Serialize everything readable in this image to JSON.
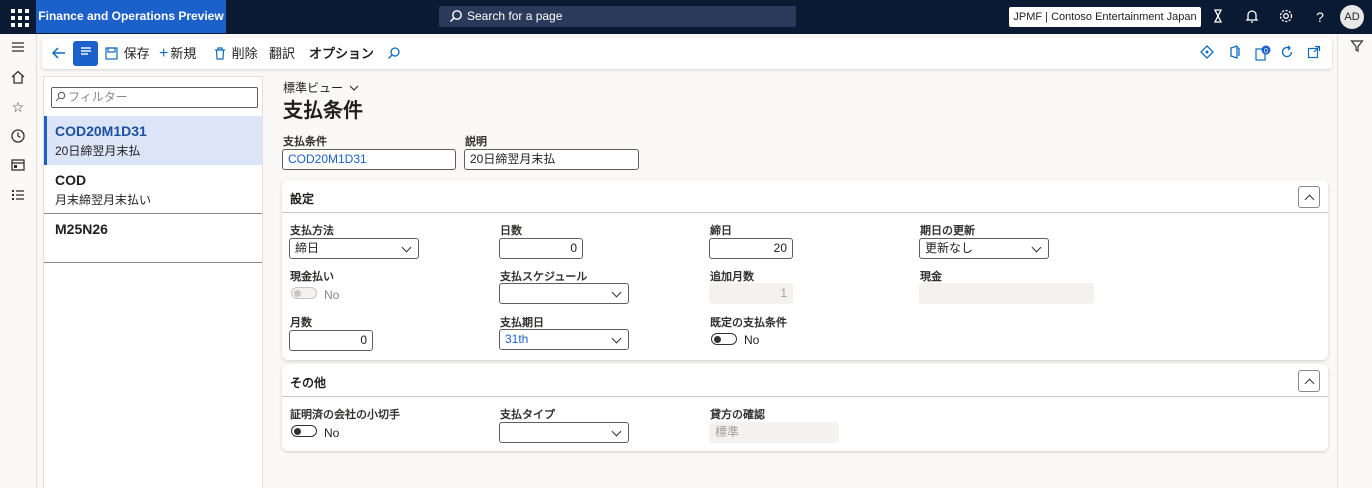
{
  "app": {
    "title": "Finance and Operations Preview",
    "search_placeholder": "Search for a page",
    "company": "JPMF | Contoso Entertainment Japan",
    "user_initials": "AD"
  },
  "actions": {
    "save": "保存",
    "new": "新規",
    "delete": "削除",
    "translate": "翻訳",
    "options": "オプション"
  },
  "list": {
    "filter_placeholder": "フィルター",
    "items": [
      {
        "code": "COD20M1D31",
        "desc": "20日締翌月末払"
      },
      {
        "code": "COD",
        "desc": "月末締翌月末払い"
      },
      {
        "code": "M25N26",
        "desc": ""
      }
    ]
  },
  "page": {
    "view": "標準ビュー",
    "title": "支払条件",
    "fields": {
      "term_label": "支払条件",
      "term_value": "COD20M1D31",
      "desc_label": "説明",
      "desc_value": "20日締翌月末払"
    }
  },
  "settings": {
    "title": "設定",
    "payment_method_label": "支払方法",
    "payment_method_value": "締日",
    "days_label": "日数",
    "days_value": "0",
    "cutoff_label": "締日",
    "cutoff_value": "20",
    "due_update_label": "期日の更新",
    "due_update_value": "更新なし",
    "cash_label": "現金払い",
    "cash_value": "No",
    "schedule_label": "支払スケジュール",
    "schedule_value": "",
    "add_months_label": "追加月数",
    "add_months_value": "1",
    "cash_account_label": "現金",
    "cash_account_value": "",
    "months_label": "月数",
    "months_value": "0",
    "payment_day_label": "支払期日",
    "payment_day_value": "31th",
    "default_label": "既定の支払条件",
    "default_value": "No"
  },
  "other": {
    "title": "その他",
    "cheque_label": "証明済の会社の小切手",
    "cheque_value": "No",
    "pay_type_label": "支払タイプ",
    "pay_type_value": "",
    "credit_label": "貸方の確認",
    "credit_value": "標準"
  }
}
